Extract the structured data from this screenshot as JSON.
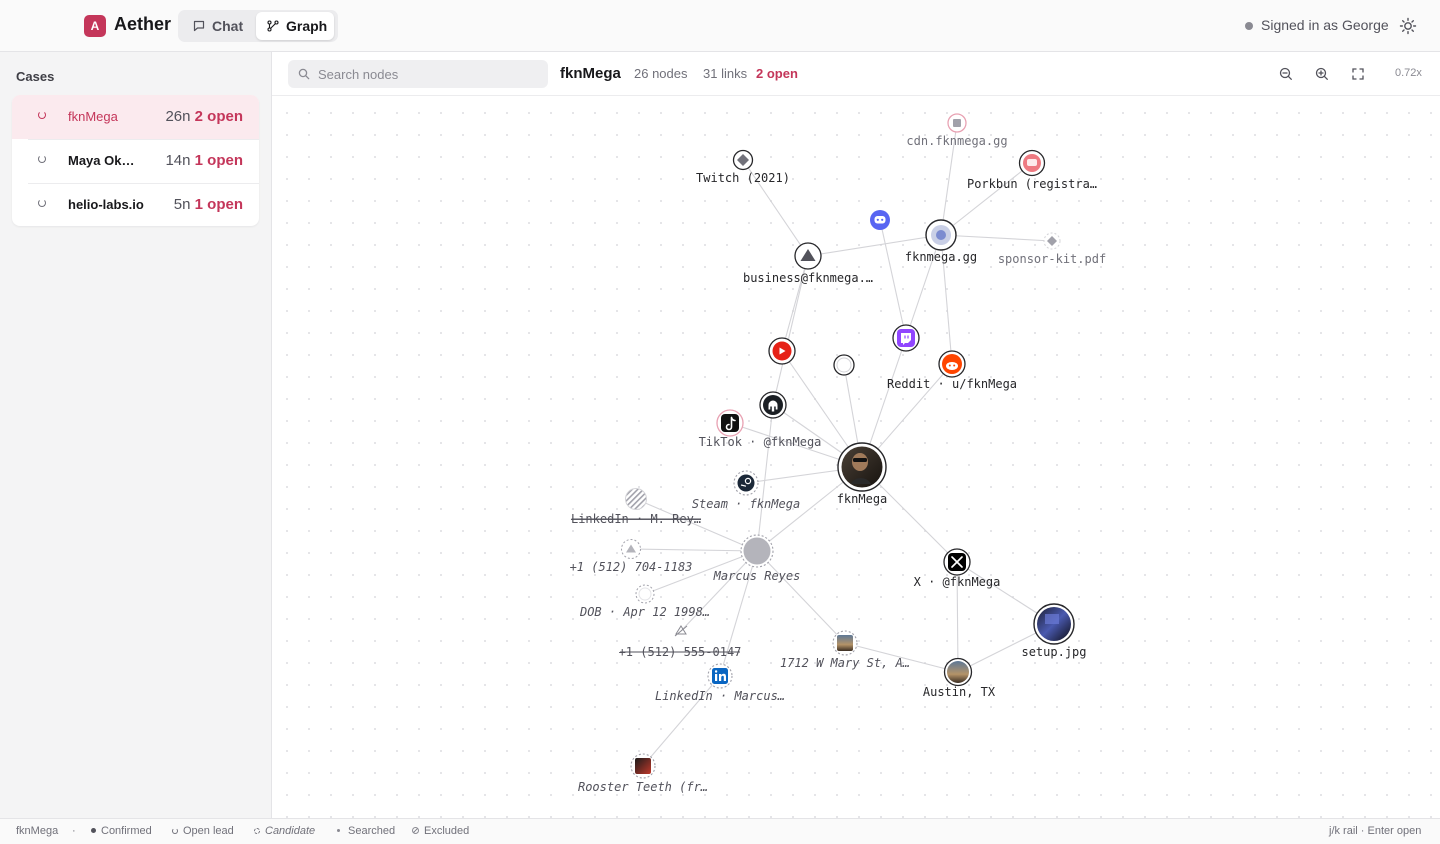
{
  "app": {
    "logo_letter": "A",
    "name": "Aether"
  },
  "modes": {
    "chat": "Chat",
    "graph": "Graph",
    "active": "Graph"
  },
  "user": {
    "signed_in_text": "Signed in as George"
  },
  "sidebar": {
    "title": "Cases",
    "cases": [
      {
        "name": "fknMega",
        "nodes": "26n",
        "open": "2 open",
        "active": true
      },
      {
        "name": "Maya Ok…",
        "nodes": "14n",
        "open": "1 open",
        "active": false
      },
      {
        "name": "helio-labs.io",
        "nodes": "5n",
        "open": "1 open",
        "active": false
      }
    ]
  },
  "toolbar": {
    "search_placeholder": "Search nodes",
    "case_name": "fknMega",
    "nodes_count": "26 nodes",
    "links_count": "31 links",
    "open_count": "2 open",
    "zoom_level": "0.72x"
  },
  "colors": {
    "accent": "#c4365a",
    "edge": "#d4d4d8",
    "confirmed": "#27272a",
    "candidate": "#a1a1aa"
  },
  "graph": {
    "nodes": [
      {
        "id": "cdn",
        "label": "cdn.fknmega.gg",
        "status": "searched",
        "icon": "square-icon"
      },
      {
        "id": "twitch2021",
        "label": "Twitch (2021)",
        "status": "confirmed",
        "icon": "diamond-icon"
      },
      {
        "id": "porkbun",
        "label": "Porkbun (registra…",
        "status": "open",
        "icon": "porkbun-icon"
      },
      {
        "id": "discord",
        "label": "",
        "status": "confirmed",
        "icon": "discord-icon"
      },
      {
        "id": "domain",
        "label": "fknmega.gg",
        "status": "confirmed",
        "icon": "globe-icon"
      },
      {
        "id": "sponsor",
        "label": "sponsor-kit.pdf",
        "status": "searched",
        "icon": "diamond-icon"
      },
      {
        "id": "email",
        "label": "business@fknmega.…",
        "status": "confirmed",
        "icon": "triangle-icon"
      },
      {
        "id": "youtube",
        "label": "",
        "status": "confirmed",
        "icon": "youtube-icon"
      },
      {
        "id": "twitch",
        "label": "",
        "status": "confirmed",
        "icon": "twitch-icon"
      },
      {
        "id": "empty",
        "label": "",
        "status": "confirmed",
        "icon": "circle-icon"
      },
      {
        "id": "reddit",
        "label": "Reddit · u/fknMega",
        "status": "confirmed",
        "icon": "reddit-icon"
      },
      {
        "id": "github",
        "label": "",
        "status": "confirmed",
        "icon": "github-icon"
      },
      {
        "id": "tiktok",
        "label": "TikTok · @fknMega",
        "status": "open",
        "icon": "tiktok-icon"
      },
      {
        "id": "main",
        "label": "fknMega",
        "status": "confirmed",
        "icon": "avatar-icon"
      },
      {
        "id": "steam",
        "label": "Steam · fknMega",
        "status": "candidate",
        "icon": "steam-icon"
      },
      {
        "id": "linkedin_m",
        "label": "LinkedIn · M. Rey…",
        "status": "excluded",
        "icon": "hatched-icon"
      },
      {
        "id": "phone1",
        "label": "+1 (512) 704-1183",
        "status": "candidate",
        "icon": "triangle-icon"
      },
      {
        "id": "marcus",
        "label": "Marcus Reyes",
        "status": "candidate",
        "icon": "person-icon"
      },
      {
        "id": "dob",
        "label": "DOB · Apr 12 1998…",
        "status": "candidate",
        "icon": "circle-icon"
      },
      {
        "id": "phone2",
        "label": "+1 (512) 555-0147",
        "status": "excluded",
        "icon": "triangle-icon"
      },
      {
        "id": "x",
        "label": "X · @fknMega",
        "status": "confirmed",
        "icon": "x-icon"
      },
      {
        "id": "address",
        "label": "1712 W Mary St, A…",
        "status": "candidate",
        "icon": "photo-icon"
      },
      {
        "id": "setup",
        "label": "setup.jpg",
        "status": "confirmed",
        "icon": "photo-icon"
      },
      {
        "id": "linkedin",
        "label": "LinkedIn · Marcus…",
        "status": "candidate",
        "icon": "linkedin-icon"
      },
      {
        "id": "austin",
        "label": "Austin, TX",
        "status": "confirmed",
        "icon": "photo-icon"
      },
      {
        "id": "rooster",
        "label": "Rooster Teeth (fr…",
        "status": "candidate",
        "icon": "photo-icon"
      }
    ]
  },
  "footer": {
    "case": "fknMega",
    "legend": [
      "Confirmed",
      "Open lead",
      "Candidate",
      "Searched",
      "Excluded"
    ],
    "hint": "j/k rail · Enter open"
  }
}
